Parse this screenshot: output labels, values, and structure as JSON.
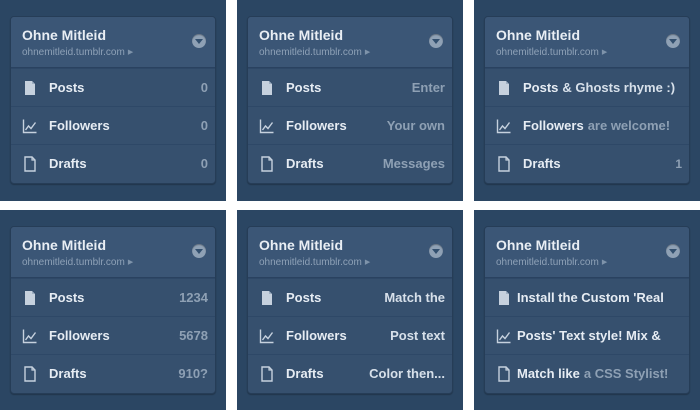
{
  "panels": [
    {
      "title": "Ohne Mitleid",
      "url": "ohnemitleid.tumblr.com",
      "rows": [
        {
          "label": "Posts",
          "value": "0"
        },
        {
          "label": "Followers",
          "value": "0"
        },
        {
          "label": "Drafts",
          "value": "0"
        }
      ]
    },
    {
      "title": "Ohne Mitleid",
      "url": "ohnemitleid.tumblr.com",
      "rows": [
        {
          "label": "Posts",
          "value": "Enter"
        },
        {
          "label": "Followers",
          "value": "Your own"
        },
        {
          "label": "Drafts",
          "value": "Messages"
        }
      ]
    },
    {
      "title": "Ohne Mitleid",
      "url": "ohnemitleid.tumblr.com",
      "rows": [
        {
          "label": "Posts",
          "value": "& Ghosts rhyme :)"
        },
        {
          "label": "Followers",
          "value": "are welcome!"
        },
        {
          "label": "Drafts",
          "value": "1"
        }
      ]
    },
    {
      "title": "Ohne Mitleid",
      "url": "ohnemitleid.tumblr.com",
      "rows": [
        {
          "label": "Posts",
          "value": "1234"
        },
        {
          "label": "Followers",
          "value": "5678"
        },
        {
          "label": "Drafts",
          "value": "910?"
        }
      ]
    },
    {
      "title": "Ohne Mitleid",
      "url": "ohnemitleid.tumblr.com",
      "rows": [
        {
          "label": "Posts",
          "value": "Match the"
        },
        {
          "label": "Followers",
          "value": "Post text"
        },
        {
          "label": "Drafts",
          "value": "Color then..."
        }
      ]
    },
    {
      "title": "Ohne Mitleid",
      "url": "ohnemitleid.tumblr.com",
      "rows": [
        {
          "label": "Install the Custom 'Real",
          "value": ""
        },
        {
          "label": "Posts' Text  style! Mix &",
          "value": ""
        },
        {
          "label": "Match like",
          "value": "a CSS Stylist!"
        }
      ]
    }
  ],
  "icons": {
    "row0": "document-icon",
    "row1": "chart-line-icon",
    "row2": "draft-icon",
    "dropdown": "chevron-down-icon",
    "url_arrow": "play-small-icon"
  },
  "colors": {
    "background": "#2b4663",
    "card": "#36506e",
    "header": "#3b5676",
    "label": "#e6ecf3",
    "value": "#8ea0b4"
  }
}
